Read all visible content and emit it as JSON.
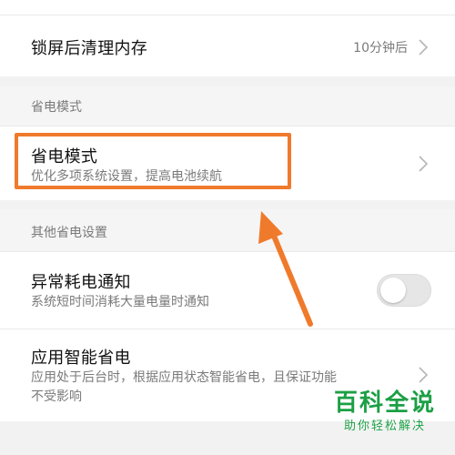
{
  "rows": {
    "lock_clear": {
      "title": "锁屏后清理内存",
      "value": "10分钟后"
    },
    "power_mode_section": {
      "header": "省电模式"
    },
    "power_mode": {
      "title": "省电模式",
      "subtitle": "优化多项系统设置，提高电池续航"
    },
    "other_section": {
      "header": "其他省电设置"
    },
    "abnormal_drain": {
      "title": "异常耗电通知",
      "subtitle": "系统短时间消耗大量电量时通知",
      "toggle_on": false
    },
    "smart_saving": {
      "title": "应用智能省电",
      "subtitle_line1": "应用处于后台时，根据应用状态智能省电，且保证功能",
      "subtitle_line2": "不受影响"
    }
  },
  "icons": {
    "chevron": "chevron-right-icon"
  },
  "colors": {
    "highlight": "#f07a2c",
    "watermark": "#1c9f45",
    "background": "#f2f2f2",
    "card": "#ffffff"
  },
  "watermark": {
    "main": "百科全说",
    "sub": "助你轻松解决"
  }
}
